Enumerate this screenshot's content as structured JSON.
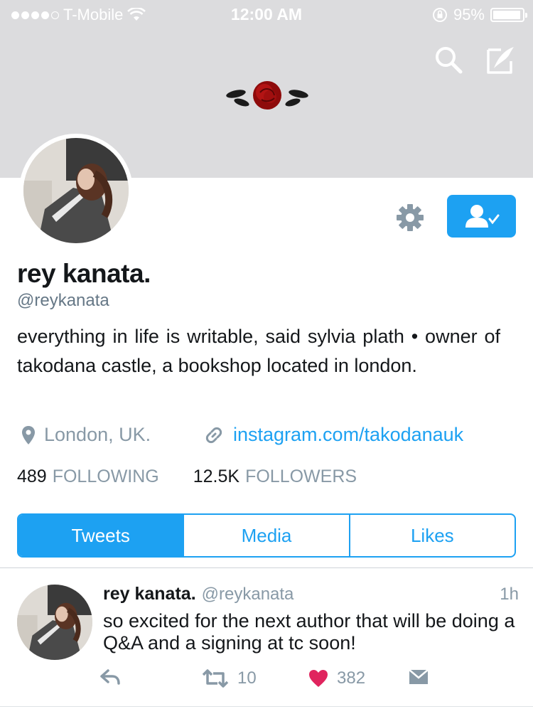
{
  "status_bar": {
    "carrier": "T-Mobile",
    "time": "12:00 AM",
    "battery_percent": "95%",
    "battery_level": 0.95
  },
  "header": {
    "icons": [
      "search-icon",
      "compose-icon"
    ],
    "banner_color": "#dcdcde"
  },
  "profile": {
    "name": "rey kanata.",
    "handle": "@reykanata",
    "bio": "everything in life is writable, said sylvia plath • owner of takodana castle, a bookshop located in london.",
    "location": "London, UK.",
    "website": "instagram.com/takodanauk",
    "following_count": "489",
    "following_label": "FOLLOWING",
    "followers_count": "12.5K",
    "followers_label": "FOLLOWERS"
  },
  "tabs": [
    {
      "label": "Tweets",
      "active": true
    },
    {
      "label": "Media",
      "active": false
    },
    {
      "label": "Likes",
      "active": false
    }
  ],
  "tweet": {
    "name": "rey kanata.",
    "handle": "@reykanata",
    "time": "1h",
    "text": "so excited for the next author that will be doing a Q&A and a signing at tc soon!",
    "retweets": "10",
    "likes": "382"
  },
  "colors": {
    "accent": "#1da1f2",
    "muted": "#8899a6",
    "like": "#e0245e"
  }
}
